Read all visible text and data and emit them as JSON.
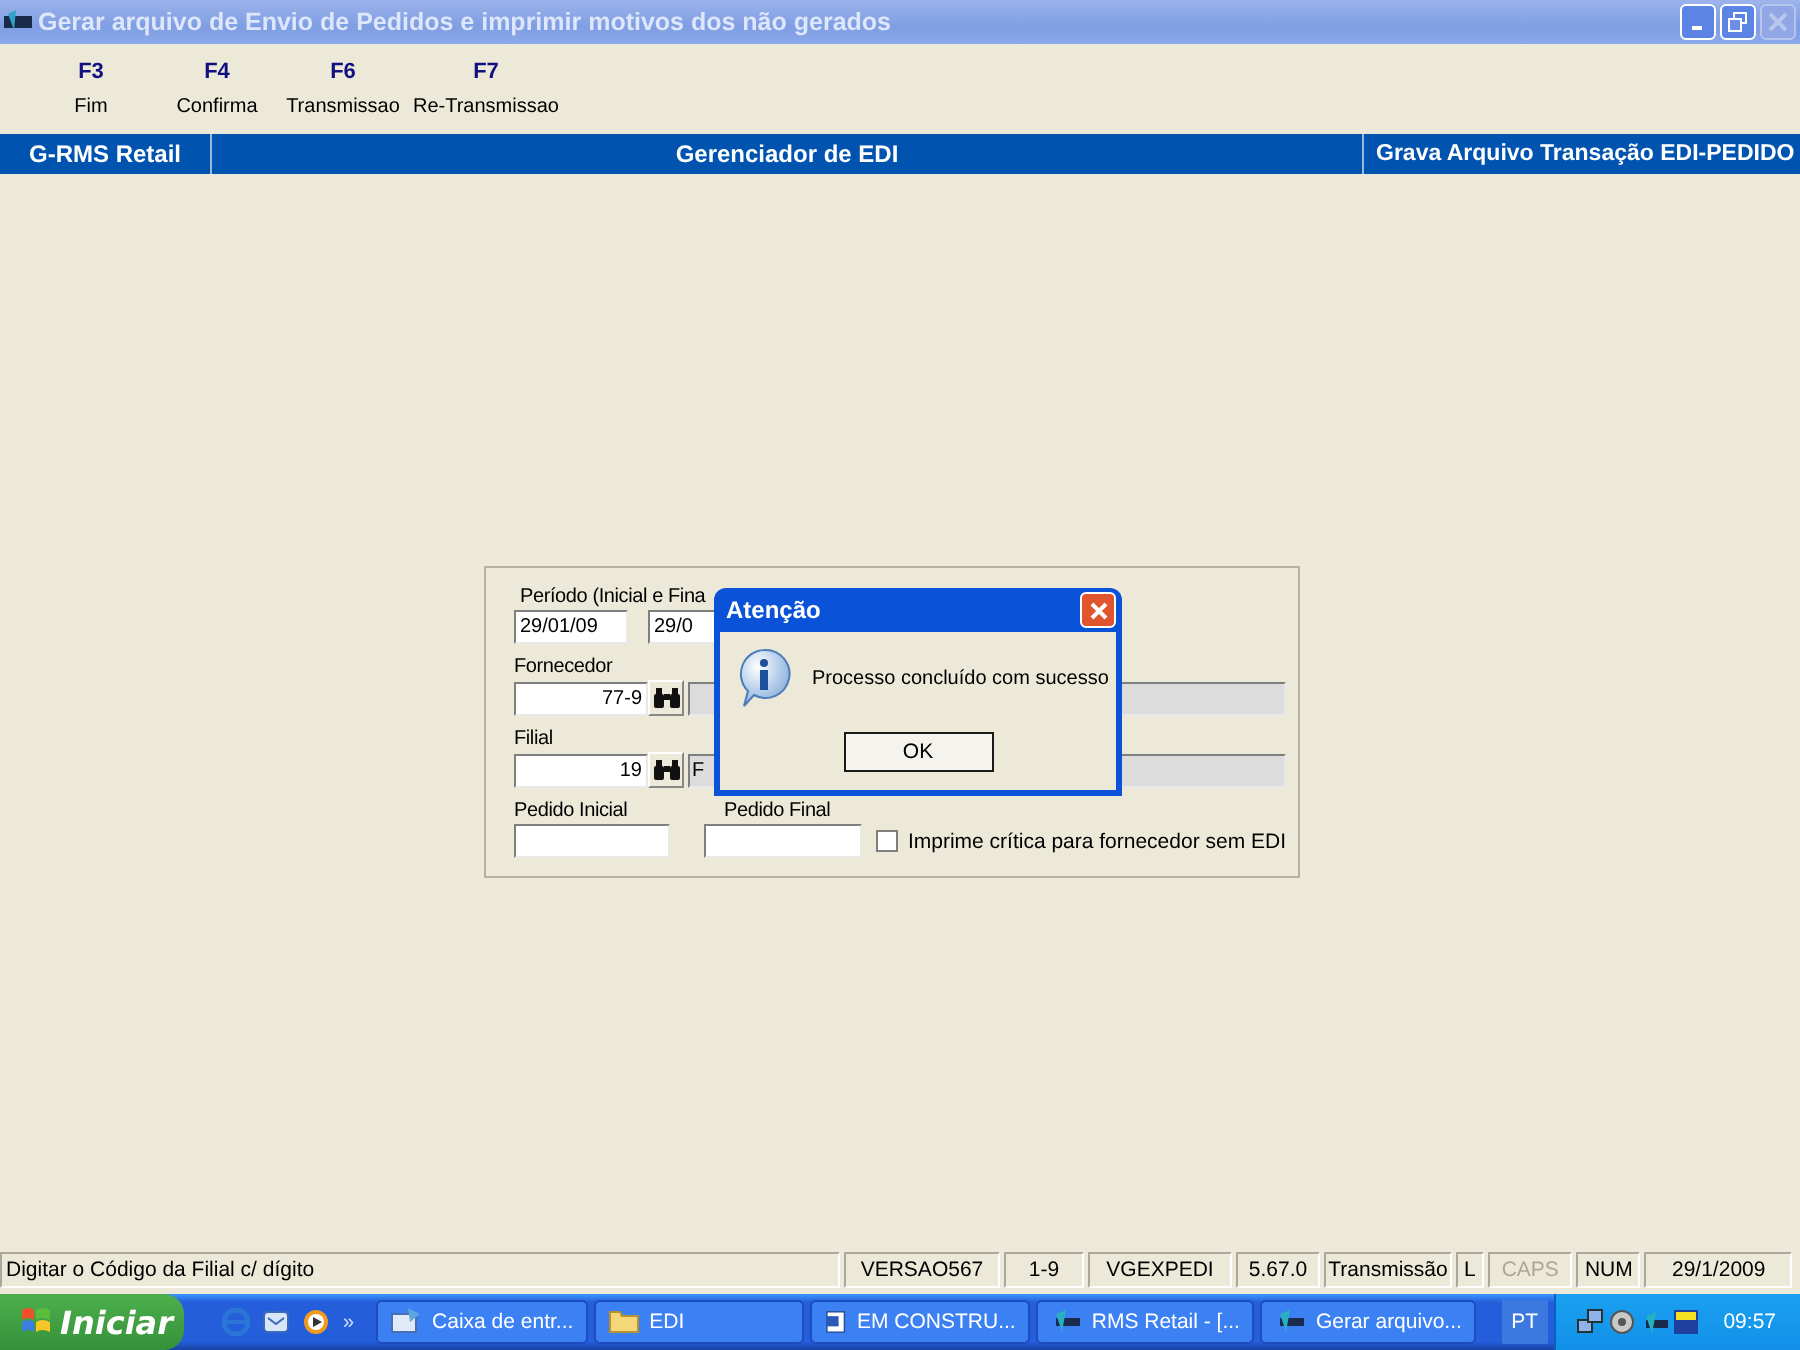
{
  "window": {
    "title": "Gerar arquivo de Envio de Pedidos e imprimir motivos dos não gerados",
    "active": false
  },
  "function_keys": [
    {
      "key": "F3",
      "label": "Fim"
    },
    {
      "key": "F4",
      "label": "Confirma"
    },
    {
      "key": "F6",
      "label": "Transmissao"
    },
    {
      "key": "F7",
      "label": "Re-Transmissao"
    }
  ],
  "header": [
    "G-RMS Retail",
    "Gerenciador de EDI",
    "Grava Arquivo Transação EDI-PEDIDO"
  ],
  "form": {
    "period_label": "Período (Inicial e Fina",
    "start_date": "29/01/09",
    "end_date": "29/0",
    "supplier_label": "Fornecedor",
    "supplier_code": "77-9",
    "branch_label": "Filial",
    "branch_code": "19",
    "branch_name": "F",
    "first_order_label": "Pedido Inicial",
    "last_order_label": "Pedido Final",
    "critique_checkbox": {
      "label": "Imprime crítica para fornecedor sem EDI",
      "checked": false
    }
  },
  "dialog": {
    "title": "Atenção",
    "message": "Processo concluído com sucesso",
    "button": "OK"
  },
  "status_bar": {
    "hint": "Digitar o Código da Filial c/ dígito",
    "panels": [
      {
        "text": "VERSAO567",
        "disabled": false
      },
      {
        "text": "1-9",
        "disabled": false
      },
      {
        "text": "VGEXPEDI",
        "disabled": false
      },
      {
        "text": "5.67.0",
        "disabled": false
      },
      {
        "text": "Transmissão",
        "disabled": false
      },
      {
        "text": "L",
        "disabled": false
      },
      {
        "text": "CAPS",
        "disabled": true
      },
      {
        "text": "NUM",
        "disabled": false
      },
      {
        "text": "29/1/2009",
        "disabled": false
      }
    ]
  },
  "taskbar": {
    "start": "Iniciar",
    "more": "»",
    "tasks": [
      {
        "label": "Caixa de entr...",
        "kind": "mail"
      },
      {
        "label": "EDI",
        "kind": "folder"
      },
      {
        "label": "EM CONSTRU...",
        "kind": "document"
      },
      {
        "label": "RMS Retail - [...",
        "kind": "app"
      },
      {
        "label": "Gerar arquivo...",
        "kind": "app"
      }
    ],
    "language": "PT",
    "clock": "09:57"
  }
}
